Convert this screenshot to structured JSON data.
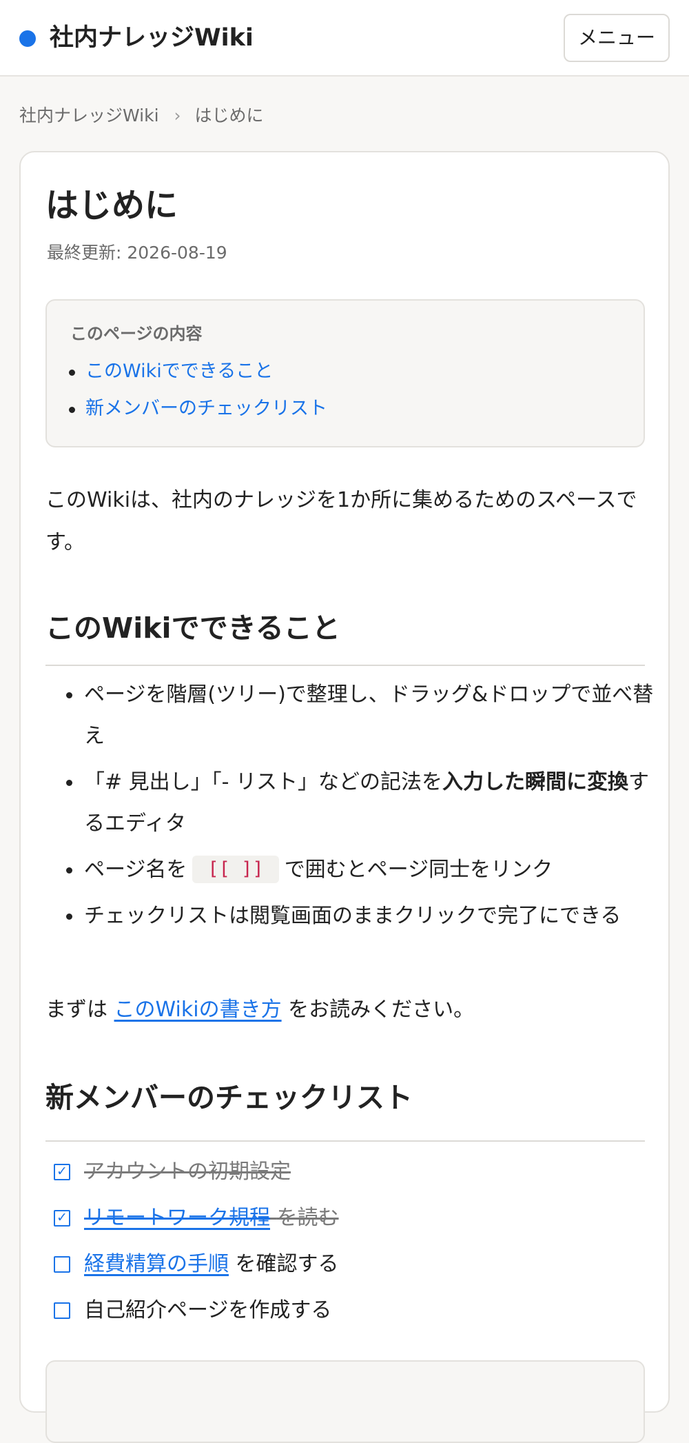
{
  "header": {
    "title": "社内ナレッジWiki",
    "menu_label": "メニュー",
    "accent_color": "#1a73e8"
  },
  "breadcrumb": {
    "items": [
      "社内ナレッジWiki",
      "はじめに"
    ],
    "separator": "›"
  },
  "page": {
    "title": "はじめに",
    "updated": "最終更新: 2026-08-19"
  },
  "toc": {
    "title": "このページの内容",
    "items": [
      "このWikiでできること",
      "新メンバーのチェックリスト"
    ]
  },
  "intro": "このWikiは、社内のナレッジを1か所に集めるためのスペースです。",
  "sections": {
    "can_do": {
      "heading": "このWikiでできること",
      "items": [
        {
          "text": "ページを階層(ツリー)で整理し、ドラッグ&ドロップで並べ替え"
        },
        {
          "before": "「# 見出し」「- リスト」などの記法を",
          "strong": "入力した瞬間に変換",
          "after": "するエディタ"
        },
        {
          "before": "ページ名を",
          "code": "[[ ]]",
          "after": "で囲むとページ同士をリンク"
        },
        {
          "text": "チェックリストは閲覧画面のままクリックで完了にできる"
        }
      ],
      "read_first": {
        "before": "まずは",
        "link": "このWikiの書き方",
        "after": "をお読みください。"
      }
    },
    "checklist": {
      "heading": "新メンバーのチェックリスト",
      "items": [
        {
          "text": "アカウントの初期設定",
          "checked": true
        },
        {
          "link": "リモートワーク規程",
          "after": "を読む",
          "checked": true
        },
        {
          "link": "経費精算の手順",
          "after": "を確認する",
          "checked": false
        },
        {
          "text": "自己紹介ページを作成する",
          "checked": false
        }
      ]
    }
  },
  "icons": {
    "logo": "logo-dot-icon",
    "checked": "checkbox-checked-icon",
    "unchecked": "checkbox-unchecked-icon"
  }
}
